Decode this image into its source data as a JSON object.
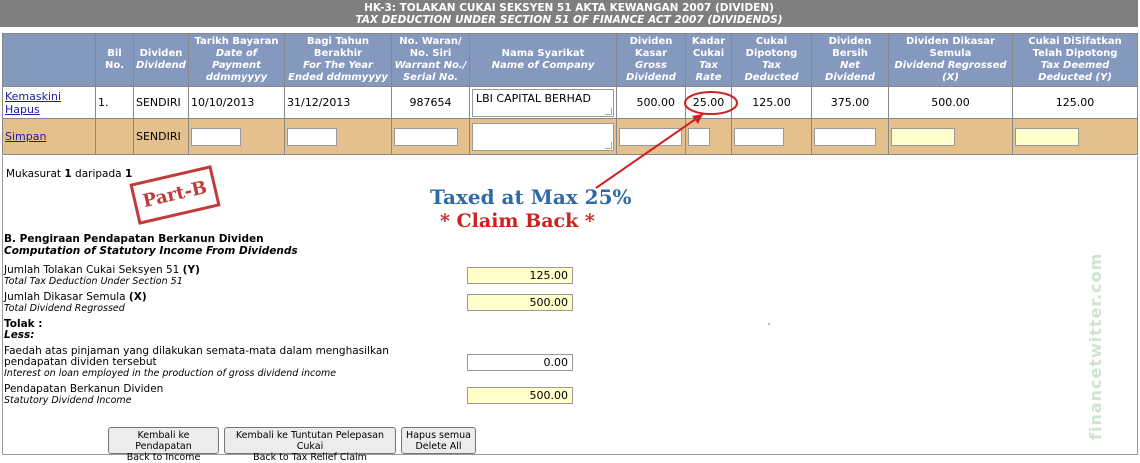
{
  "header": {
    "title": "HK-3: TOLAKAN CUKAI SEKSYEN 51 AKTA KEWANGAN 2007 (DIVIDEN)",
    "subtitle": "TAX DEDUCTION UNDER SECTION 51 OF FINANCE ACT 2007 (DIVIDENDS)"
  },
  "columns": {
    "bil": "Bil No.",
    "dividend_ms": "Dividen",
    "dividend_en": "Dividend",
    "date_ms": "Tarikh Bayaran",
    "date_en": "Date of Payment ddmmyyyy",
    "year_ms": "Bagi Tahun Berakhir",
    "year_en": "For The Year Ended ddmmyyyy",
    "warrant_ms": "No. Waran/ No. Siri",
    "warrant_en": "Warrant No./ Serial No.",
    "company_ms": "Nama Syarikat",
    "company_en": "Name of Company",
    "gross_ms": "Dividen Kasar",
    "gross_en": "Gross Dividend",
    "rate_ms": "Kadar Cukai",
    "rate_en": "Tax Rate",
    "taxded_ms": "Cukai Dipotong",
    "taxded_en": "Tax Deducted",
    "net_ms": "Dividen Bersih",
    "net_en": "Net Dividend",
    "regross_ms": "Dividen Dikasar Semula",
    "regross_en": "Dividend Regrossed (X)",
    "deemed_ms": "Cukai DiSifatkan Telah Dipotong",
    "deemed_en": "Tax Deemed Deducted (Y)"
  },
  "row": {
    "edit_label": "Kemaskini",
    "delete_label": "Hapus",
    "bil": "1.",
    "dividend": "SENDIRI",
    "date": "10/10/2013",
    "year_end": "31/12/2013",
    "warrant": "987654",
    "company": "LBI CAPITAL BERHAD",
    "gross": "500.00",
    "rate": "25.00",
    "tax_deducted": "125.00",
    "net": "375.00",
    "regrossed": "500.00",
    "deemed": "125.00"
  },
  "new_row": {
    "save_label": "Simpan",
    "dividend": "SENDIRI"
  },
  "pagination": {
    "prefix": "Mukasurat",
    "page": "1",
    "of": "daripada",
    "total": "1"
  },
  "annotations": {
    "stamp": "Part-B",
    "callout1": "Taxed at Max 25%",
    "callout2": "* Claim Back *",
    "watermark": "financetwitter.com"
  },
  "section_b": {
    "title_ms": "B. Pengiraan Pendapatan Berkanun Dividen",
    "title_en": "Computation of Statutory Income From Dividends",
    "rows": [
      {
        "label_ms": "Jumlah Tolakan Cukai Seksyen 51",
        "tag": "(Y)",
        "label_en": "Total Tax Deduction Under Section 51",
        "value": "125.00"
      },
      {
        "label_ms": "Jumlah Dikasar Semula",
        "tag": "(X)",
        "label_en": "Total Dividend Regrossed",
        "value": "500.00"
      }
    ],
    "less_ms": "Tolak :",
    "less_en": "Less:",
    "interest_ms": "Faedah atas pinjaman yang dilakukan semata-mata dalam menghasilkan pendapatan dividen tersebut",
    "interest_en": "Interest on loan employed in the production of gross dividend income",
    "interest_value": "0.00",
    "statutory_ms": "Pendapatan Berkanun Dividen",
    "statutory_en": "Statutory Dividend Income",
    "statutory_value": "500.00"
  },
  "buttons": {
    "back_income_1": "Kembali ke Pendapatan",
    "back_income_2": "Back to Income",
    "back_relief_1": "Kembali ke Tuntutan Pelepasan Cukai",
    "back_relief_2": "Back to Tax Relief Claim",
    "delete_all_1": "Hapus semua",
    "delete_all_2": "Delete All"
  }
}
